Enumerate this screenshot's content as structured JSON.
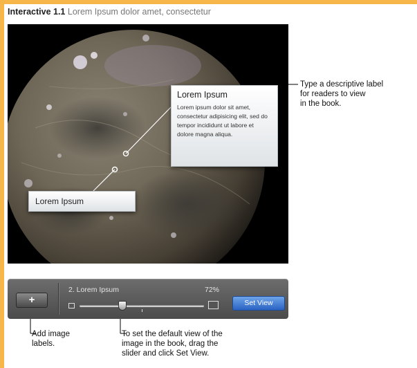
{
  "caption": {
    "label": "Interactive 1.1",
    "text": "Lorem Ipsum dolor amet, consectetur"
  },
  "labels": {
    "big": {
      "title": "Lorem Ipsum",
      "body": "Lorem ipsum dolor sit amet, consectetur adipisicing elit, sed do tempor incididunt ut labore et dolore magna aliqua."
    },
    "small": {
      "title": "Lorem Ipsum"
    }
  },
  "notes": {
    "label_note": [
      "Type a descriptive label",
      "for readers to view",
      "in the book."
    ],
    "add_note": [
      "Add image",
      "labels."
    ],
    "view_note": [
      "To set the default view of the",
      "image in the book, drag the",
      "slider and click Set View."
    ]
  },
  "toolbar": {
    "add_label": "+",
    "title": "2. Lorem Ipsum",
    "zoom": "72%",
    "zoom_value": 0.72,
    "set_view_label": "Set View"
  }
}
